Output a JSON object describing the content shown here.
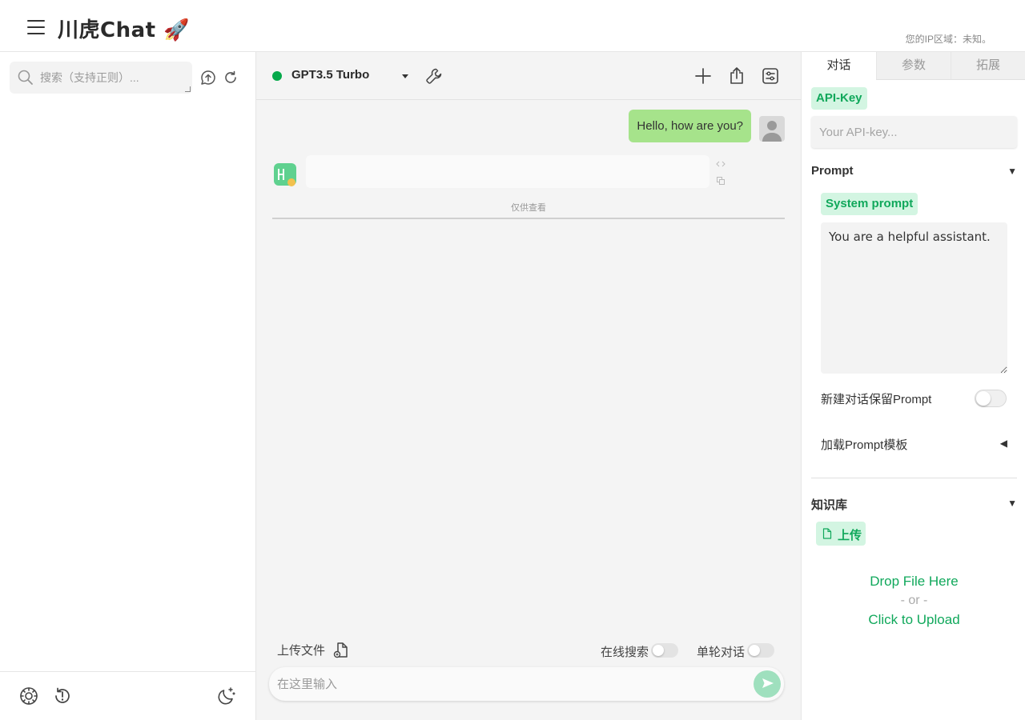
{
  "header": {
    "title": "川虎Chat 🚀",
    "ip_info": "您的IP区域：未知。"
  },
  "sidebar": {
    "search_placeholder": "搜索（支持正则）...",
    "icons": [
      "search-icon",
      "upload-history-icon",
      "refresh-icon"
    ],
    "footer_icons": [
      "settings-icon",
      "history-icon",
      "dark-mode-icon"
    ]
  },
  "chat": {
    "model_name": "GPT3.5 Turbo",
    "status_color": "#06a94b",
    "user_message": "Hello, how are you?",
    "bot_message": "",
    "view_only": "仅供查看",
    "upload_file": "上传文件",
    "online_search": "在线搜索",
    "single_turn": "单轮对话",
    "input_placeholder": "在这里输入",
    "accent_user_bubble": "#a6e38b"
  },
  "panel": {
    "tabs": [
      "对话",
      "参数",
      "拓展"
    ],
    "active_tab": "对话",
    "api_key_label": "API-Key",
    "api_key_placeholder": "Your API-key...",
    "prompt_section": "Prompt",
    "system_prompt_label": "System prompt",
    "system_prompt_value": "You are a helpful assistant.",
    "keep_prompt_label": "新建对话保留Prompt",
    "load_template_label": "加载Prompt模板",
    "knowledge_section": "知识库",
    "upload_label": "上传",
    "drop_text": "Drop File Here",
    "or_text": "- or -",
    "click_upload": "Click to Upload",
    "accent_green": "#10a85b"
  }
}
